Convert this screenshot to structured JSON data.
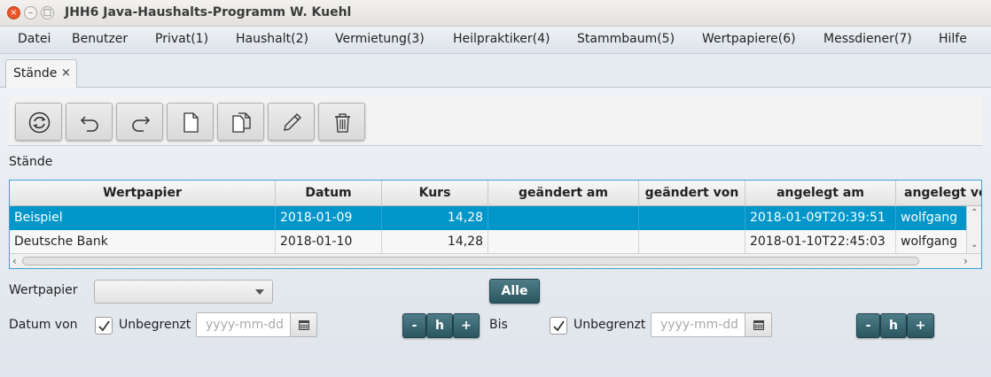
{
  "window": {
    "title": "JHH6 Java-Haushalts-Programm W. Kuehl"
  },
  "menu": [
    "Datei",
    "Benutzer",
    "Privat(1)",
    "Haushalt(2)",
    "Vermietung(3)",
    "Heilpraktiker(4)",
    "Stammbaum(5)",
    "Wertpapiere(6)",
    "Messdiener(7)",
    "Hilfe"
  ],
  "tab": {
    "label": "Stände",
    "close": "×"
  },
  "toolbar": {
    "icons": [
      "refresh-icon",
      "undo-icon",
      "redo-icon",
      "new-document-icon",
      "copy-document-icon",
      "edit-pencil-icon",
      "delete-trash-icon"
    ]
  },
  "section_label": "Stände",
  "table": {
    "columns": [
      "Wertpapier",
      "Datum",
      "Kurs",
      "geändert am",
      "geändert von",
      "angelegt am",
      "angelegt von"
    ],
    "rows": [
      {
        "wertpapier": "Beispiel",
        "datum": "2018-01-09",
        "kurs": "14,28",
        "geaendert_am": "",
        "geaendert_von": "",
        "angelegt_am": "2018-01-09T20:39:51",
        "angelegt_von": "wolfgang",
        "selected": true
      },
      {
        "wertpapier": "Deutsche Bank",
        "datum": "2018-01-10",
        "kurs": "14,28",
        "geaendert_am": "",
        "geaendert_von": "",
        "angelegt_am": "2018-01-10T22:45:03",
        "angelegt_von": "wolfgang",
        "selected": false
      }
    ]
  },
  "form": {
    "wertpapier_label": "Wertpapier",
    "wertpapier_value": "",
    "alle_button": "Alle",
    "datum_von_label": "Datum von",
    "unbegrenzt_label": "Unbegrenzt",
    "date_placeholder": "yyyy-mm-dd",
    "bis_label": "Bis",
    "minus": "-",
    "h": "h",
    "plus": "+",
    "datum_von_unbegrenzt_checked": true,
    "bis_unbegrenzt_checked": true
  },
  "colors": {
    "selection": "#0096c9",
    "accent_button": "#2a5661",
    "close_button": "#e8552b"
  }
}
